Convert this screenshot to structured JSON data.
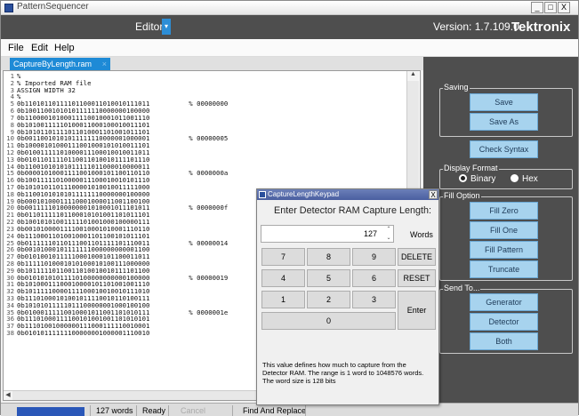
{
  "window": {
    "title": "PatternSequencer",
    "min": "_",
    "max": "□",
    "close": "X"
  },
  "header": {
    "mode": "Editor",
    "mode_dropdown": "▾",
    "version": "Version: 1.7.109.0",
    "logo": "Tektronix"
  },
  "menu": [
    "File",
    "Edit",
    "Help"
  ],
  "tab": {
    "name": "CaptureByLength.ram",
    "close": "×"
  },
  "editor": {
    "lines": [
      "%",
      "% Imported RAM file",
      "ASSIGN WIDTH 32",
      "%",
      "0b11010110111101100011010010111011          % 00000000",
      "0b10011001010101111110000000100000",
      "0b11000010100011110010001011001110",
      "0b10100111110100011000100010011101",
      "0b10101101111011010001101001011101",
      "0b00110010101011111110000001000001          % 00000005",
      "0b10000101000111001000101010011101",
      "0b01001111101000011100010010011011",
      "0b01011011110110011010010111101110",
      "0b11001010101011111011000010000011",
      "0b00001010001111001000101100110110          % 0000000a",
      "0b10011111010000011100010010101110",
      "0b10101011011100001010010011111000",
      "0b11001010101011111110000000100000",
      "0b00010100011110001000011001100100",
      "0b00111110100000001010001011101011          % 0000000f",
      "0b01101111101100010101001101011101",
      "0b10010101001111101001000100000111",
      "0b00101000011110010001010001110110",
      "0b11100011010010001101100101011101",
      "0b01111110110111001101111101110011          % 00000014",
      "0b00101000101111111000000000001100",
      "0b01010010111110001000101100011011",
      "0b11111010001010100010100111000000",
      "0b10111110110011010010010111101100",
      "0b01010101011110100000000000100000          % 00000019",
      "0b10100011100010000101101001001110",
      "0b10111110000111100010010010111010",
      "0b11101000101001011110010110100111",
      "0b10101011111011100000001000100100",
      "0b01000111110010001011001101010111          % 0000001e",
      "0b11101000111100101001001101010101",
      "0b11101001000000111000111110010001",
      "0b01010111111100000001000001110010"
    ]
  },
  "panel": {
    "saving": {
      "label": "Saving",
      "save": "Save",
      "save_as": "Save As"
    },
    "check_syntax": "Check Syntax",
    "display_format": {
      "label": "Display Format",
      "binary": "Binary",
      "hex": "Hex",
      "selected": "Binary"
    },
    "fill_option": {
      "label": "Fill Option",
      "fill_zero": "Fill Zero",
      "fill_one": "Fill One",
      "fill_pattern": "Fill Pattern",
      "truncate": "Truncate"
    },
    "send_to": {
      "label": "Send To...",
      "generator": "Generator",
      "detector": "Detector",
      "both": "Both"
    }
  },
  "status": {
    "words": "127 words",
    "state": "Ready",
    "cancel": "Cancel",
    "find_replace": "Find And Replace"
  },
  "dialog": {
    "title": "CaptureLengthKeypad",
    "close": "X",
    "prompt": "Enter Detector RAM Capture Length:",
    "value": "127",
    "unit": "Words",
    "keys": {
      "k7": "7",
      "k8": "8",
      "k9": "9",
      "k4": "4",
      "k5": "5",
      "k6": "6",
      "k1": "1",
      "k2": "2",
      "k3": "3",
      "k0": "0"
    },
    "delete": "DELETE",
    "reset": "RESET",
    "enter": "Enter",
    "info": "This value defines how much to capture from the Detector RAM. The range is 1 word to 1048576 words. The word size is 128 bits"
  },
  "colors": {
    "header_bg": "#4e4e4e",
    "accent_blue": "#1e8ad6",
    "panel_button": "#a7d3ee"
  }
}
